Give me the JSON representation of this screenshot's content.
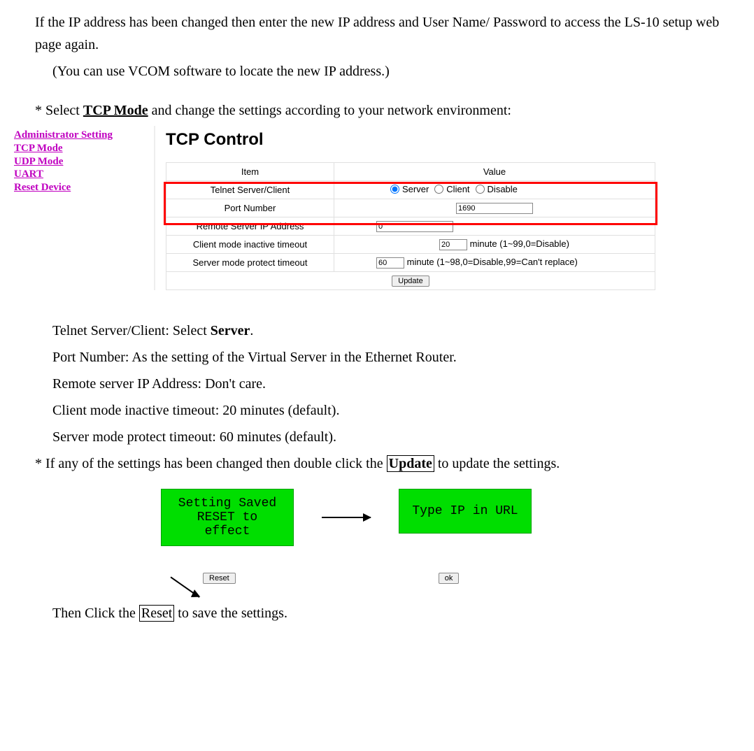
{
  "intro": {
    "p1": "If the IP address has been changed then enter the new IP address and User Name/ Password to access the LS-10 setup web page again.",
    "p2": "(You can use VCOM software to locate the new IP address.)"
  },
  "select_tcp": {
    "prefix": "* Select ",
    "link": "TCP Mode",
    "suffix": " and change the settings according to your network environment:"
  },
  "sidebar": {
    "admin": "Administrator Setting",
    "tcp": "TCP Mode",
    "udp": "UDP Mode",
    "uart": "UART",
    "reset": "Reset Device"
  },
  "panel": {
    "title": "TCP Control",
    "header_item": "Item",
    "header_value": "Value",
    "rows": {
      "telnet": {
        "label": "Telnet Server/Client",
        "opt_server": "Server",
        "opt_client": "Client",
        "opt_disable": "Disable"
      },
      "port": {
        "label": "Port Number",
        "value": "1690"
      },
      "remote": {
        "label": "Remote Server IP Address",
        "value": "0"
      },
      "client_to": {
        "label": "Client mode inactive timeout",
        "value": "20",
        "suffix": "minute (1~99,0=Disable)"
      },
      "server_to": {
        "label": "Server mode protect timeout",
        "value": "60",
        "suffix": "minute (1~98,0=Disable,99=Can't replace)"
      }
    },
    "update_btn": "Update"
  },
  "explain": {
    "telnet": "Telnet Server/Client: Select ",
    "telnet_b": "Server",
    "telnet_suffix": ".",
    "port": "Port Number: As the setting of the Virtual Server in the Ethernet Router.",
    "remote": "Remote server IP Address: Don't care.",
    "client": "Client mode inactive timeout: 20 minutes (default).",
    "server": "Server mode protect timeout: 60 minutes (default)."
  },
  "update_note": {
    "prefix": "* If any of the settings has been changed then double click the ",
    "word": "Update",
    "suffix": " to update the settings."
  },
  "green": {
    "left_l1": "Setting Saved",
    "left_l2": "RESET to effect",
    "right": "Type IP in URL"
  },
  "buttons": {
    "reset": "Reset",
    "ok": "ok"
  },
  "reset_note": {
    "prefix": "Then Click the ",
    "word": "Reset",
    "suffix": " to save the settings."
  }
}
